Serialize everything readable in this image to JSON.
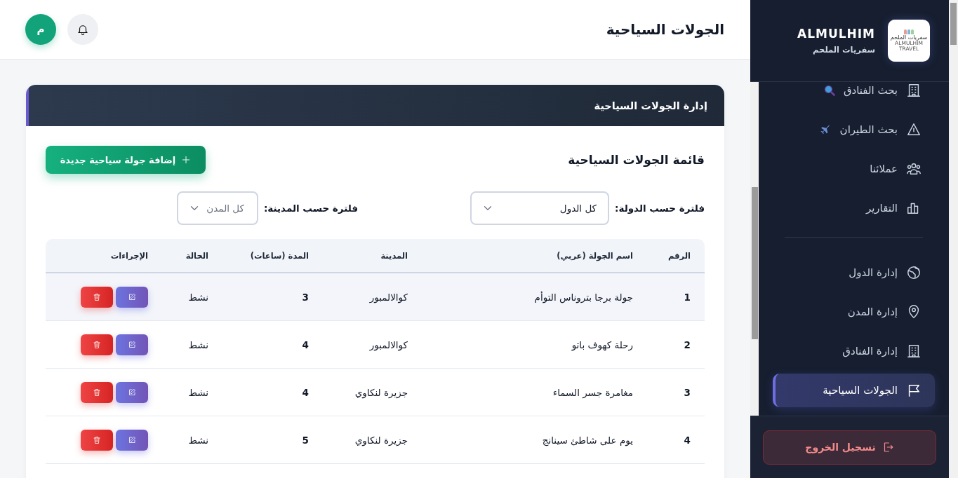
{
  "sidebar": {
    "brand": {
      "name": "ALMULHIM",
      "subtitle": "سفريات الملحم",
      "logo_text": "سفريات الملحم",
      "logo_subtext": "ALMULHIM TRAVEL"
    },
    "sections": [
      {
        "items": [
          {
            "label": "بحث الفنادق",
            "selected": false
          },
          {
            "label": "بحث الطيران",
            "selected": false
          },
          {
            "label": "عملائنا",
            "selected": false
          },
          {
            "label": "التقارير",
            "selected": false
          }
        ]
      },
      {
        "items": [
          {
            "label": "إدارة الدول",
            "selected": false
          },
          {
            "label": "إدارة المدن",
            "selected": false
          },
          {
            "label": "إدارة الفنادق",
            "selected": false
          },
          {
            "label": "الجولات السياحية",
            "selected": true
          }
        ]
      }
    ],
    "logout": {
      "label": "تسجيل الخروج"
    }
  },
  "topbar": {
    "title": "الجولات السياحية",
    "avatar": "م"
  },
  "card": {
    "title": "إدارة الجولات السياحية",
    "list_title": "قائمة الجولات السياحية",
    "add_button": "إضافة جولة سياحية جديدة",
    "filters": [
      {
        "label": "فلترة حسب الدولة:",
        "value": "كل الدول"
      },
      {
        "label": "فلترة حسب المدينة:",
        "placeholder": "كل المدن"
      }
    ],
    "table": {
      "columns": [
        "الرقم",
        "اسم الجولة (عربي)",
        "المدينة",
        "المدة (ساعات)",
        "الحالة",
        "الإجراءات"
      ],
      "rows": [
        {
          "cells": [
            "1",
            "جولة برجا بتروناس التوأم",
            "كوالالمبور",
            "3",
            "نشط"
          ],
          "selected": true
        },
        {
          "cells": [
            "2",
            "رحلة كهوف باتو",
            "كوالالمبور",
            "4",
            "نشط"
          ],
          "selected": false
        },
        {
          "cells": [
            "3",
            "مغامرة جسر السماء",
            "جزيرة لنكاوي",
            "4",
            "نشط"
          ],
          "selected": false
        },
        {
          "cells": [
            "4",
            "يوم على شاطئ سينانج",
            "جزيرة لنكاوي",
            "5",
            "نشط"
          ],
          "selected": false
        }
      ]
    }
  }
}
